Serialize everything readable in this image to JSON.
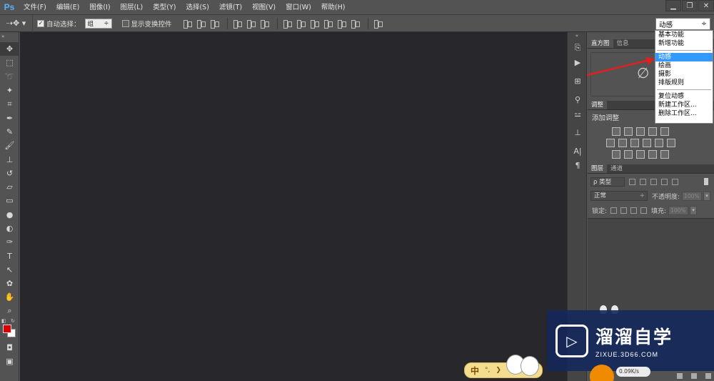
{
  "app": {
    "logo": "Ps"
  },
  "menu": [
    "文件(F)",
    "编辑(E)",
    "图像(I)",
    "图层(L)",
    "类型(Y)",
    "选择(S)",
    "滤镜(T)",
    "视图(V)",
    "窗口(W)",
    "帮助(H)"
  ],
  "window_controls": {
    "minimize": "▁",
    "restore": "❐",
    "close": "✕"
  },
  "options": {
    "auto_select_label": "自动选择：",
    "auto_select_value": "组",
    "show_transform_label": "显示变换控件"
  },
  "workspace": {
    "selected": "动感",
    "items_group1": [
      "基本功能",
      "新增功能"
    ],
    "items_group2": [
      "动感",
      "绘画",
      "摄影",
      "排版规则"
    ],
    "items_group3": [
      "复位动感",
      "新建工作区...",
      "删除工作区..."
    ]
  },
  "panels": {
    "histogram_tab": "直方图",
    "info_tab": "信息",
    "adjustments_tab": "调整",
    "add_adjustment": "添加调整",
    "layers_tab": "图层",
    "channels_tab": "通道",
    "filter_kind": "ρ 类型",
    "blend_mode": "正常",
    "opacity_label": "不透明度:",
    "opacity_value": "100%",
    "lock_label": "锁定:",
    "fill_label": "填充:",
    "fill_value": "100%"
  },
  "colors": {
    "foreground": "#e10000",
    "background": "#ffffff"
  },
  "watermark": {
    "name": "溜溜自学",
    "url": "ZIXUE.3D66.COM"
  },
  "ime": {
    "mode": "中",
    "sym1": "°,",
    "sym2": "❯"
  },
  "speed": {
    "text": "0.09K/s"
  }
}
